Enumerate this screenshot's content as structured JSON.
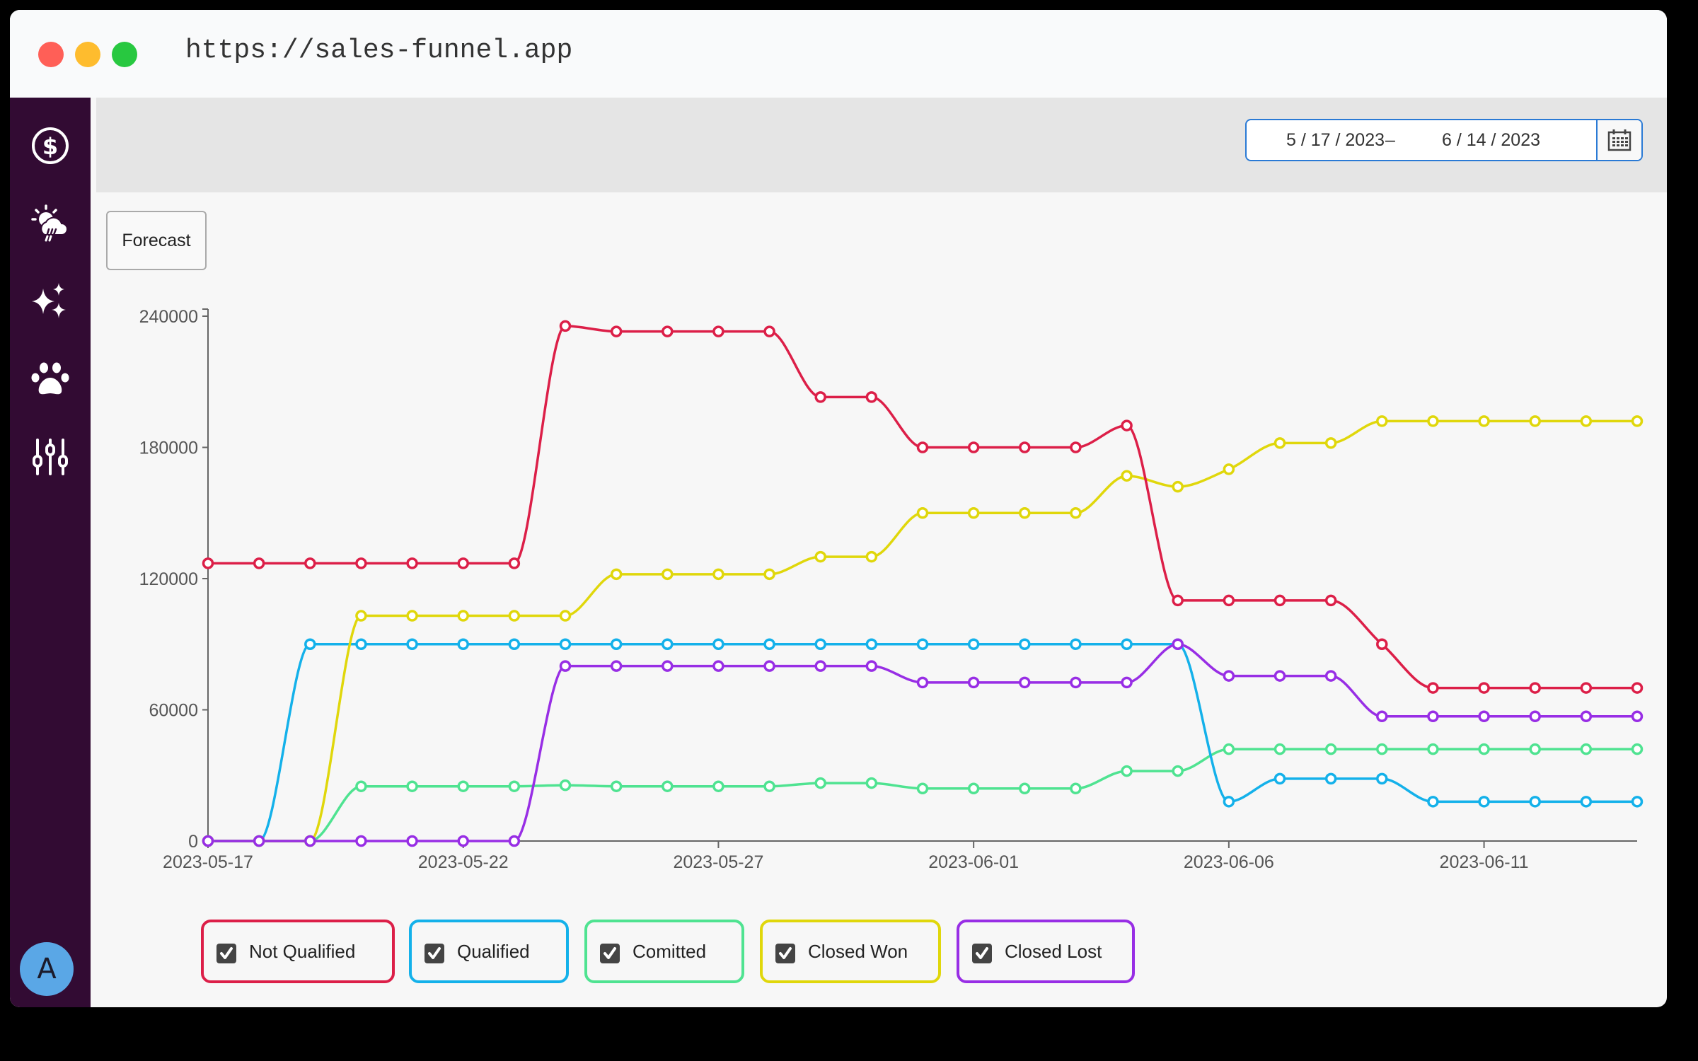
{
  "browser": {
    "url": "https://sales-funnel.app"
  },
  "sidebar": {
    "items": [
      {
        "name": "sales",
        "icon": "dollar-circle-icon"
      },
      {
        "name": "weather",
        "icon": "sun-cloud-rain-icon"
      },
      {
        "name": "sparkles",
        "icon": "sparkles-icon"
      },
      {
        "name": "pets",
        "icon": "paw-icon"
      },
      {
        "name": "settings",
        "icon": "sliders-icon"
      }
    ],
    "avatar_initial": "A"
  },
  "toolbar": {
    "date_start": "5 / 17 / 2023",
    "date_separator": "–",
    "date_end": "6 / 14 / 2023",
    "calendar_icon": "calendar-icon"
  },
  "forecast_label": "Forecast",
  "colors": {
    "not_qualified": "#dc1f48",
    "qualified": "#14b1ea",
    "committed": "#4fe391",
    "closed_won": "#e0d70b",
    "closed_lost": "#982ee5"
  },
  "legend": [
    {
      "label": "Not Qualified",
      "checked": true,
      "color": "#dc1f48"
    },
    {
      "label": "Qualified",
      "checked": true,
      "color": "#14b1ea"
    },
    {
      "label": "Comitted",
      "checked": true,
      "color": "#4fe391"
    },
    {
      "label": "Closed Won",
      "checked": true,
      "color": "#e0d70b"
    },
    {
      "label": "Closed Lost",
      "checked": true,
      "color": "#982ee5"
    }
  ],
  "chart_data": {
    "type": "line",
    "title": "",
    "xlabel": "",
    "ylabel": "",
    "ylim": [
      0,
      240000
    ],
    "yticks": [
      "0",
      "60000",
      "120000",
      "180000",
      "240000"
    ],
    "xticks": [
      "2023-05-17",
      "2023-05-22",
      "2023-05-27",
      "2023-06-01",
      "2023-06-06",
      "2023-06-11"
    ],
    "grid": false,
    "legend_position": "bottom",
    "x": [
      "2023-05-17",
      "2023-05-18",
      "2023-05-19",
      "2023-05-20",
      "2023-05-21",
      "2023-05-22",
      "2023-05-23",
      "2023-05-24",
      "2023-05-25",
      "2023-05-26",
      "2023-05-27",
      "2023-05-28",
      "2023-05-29",
      "2023-05-30",
      "2023-05-31",
      "2023-06-01",
      "2023-06-02",
      "2023-06-03",
      "2023-06-04",
      "2023-06-05",
      "2023-06-06",
      "2023-06-07",
      "2023-06-08",
      "2023-06-09",
      "2023-06-10",
      "2023-06-11",
      "2023-06-12",
      "2023-06-13",
      "2023-06-14"
    ],
    "series": [
      {
        "name": "Not Qualified",
        "color": "#dc1f48",
        "values": [
          127000,
          127000,
          127000,
          127000,
          127000,
          127000,
          127000,
          235500,
          233000,
          233000,
          233000,
          233000,
          203000,
          203000,
          180000,
          180000,
          180000,
          180000,
          190000,
          110000,
          110000,
          110000,
          110000,
          90000,
          70000,
          70000,
          70000,
          70000,
          70000
        ]
      },
      {
        "name": "Qualified",
        "color": "#14b1ea",
        "values": [
          0,
          0,
          90000,
          90000,
          90000,
          90000,
          90000,
          90000,
          90000,
          90000,
          90000,
          90000,
          90000,
          90000,
          90000,
          90000,
          90000,
          90000,
          90000,
          90000,
          18000,
          28500,
          28500,
          28500,
          18000,
          18000,
          18000,
          18000,
          18000
        ]
      },
      {
        "name": "Comitted",
        "color": "#4fe391",
        "values": [
          0,
          0,
          0,
          25000,
          25000,
          25000,
          25000,
          25500,
          25000,
          25000,
          25000,
          25000,
          26500,
          26500,
          24000,
          24000,
          24000,
          24000,
          32000,
          32000,
          42000,
          42000,
          42000,
          42000,
          42000,
          42000,
          42000,
          42000,
          42000
        ]
      },
      {
        "name": "Closed Won",
        "color": "#e0d70b",
        "values": [
          0,
          0,
          0,
          103000,
          103000,
          103000,
          103000,
          103000,
          122000,
          122000,
          122000,
          122000,
          130000,
          130000,
          150000,
          150000,
          150000,
          150000,
          167000,
          162000,
          170000,
          182000,
          182000,
          192000,
          192000,
          192000,
          192000,
          192000,
          192000
        ]
      },
      {
        "name": "Closed Lost",
        "color": "#982ee5",
        "values": [
          0,
          0,
          0,
          0,
          0,
          0,
          0,
          80000,
          80000,
          80000,
          80000,
          80000,
          80000,
          80000,
          72500,
          72500,
          72500,
          72500,
          72500,
          90000,
          75500,
          75500,
          75500,
          57000,
          57000,
          57000,
          57000,
          57000,
          57000
        ]
      }
    ]
  }
}
